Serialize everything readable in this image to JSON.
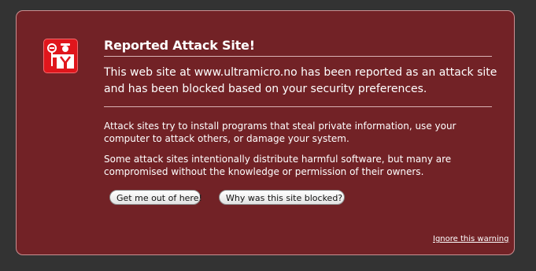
{
  "panel": {
    "title": "Reported Attack Site!",
    "intro": "This web site at www.ultramicro.no has been reported as an attack site and has been blocked based on your security preferences.",
    "paragraphs": [
      "Attack sites try to install programs that steal private information, use your computer to attack others, or damage your system.",
      "Some attack sites intentionally distribute harmful software, but many are compromised without the knowledge or permission of their owners."
    ],
    "buttons": {
      "get_out": "Get me out of here!",
      "why_blocked": "Why was this site blocked?"
    },
    "ignore_link": "Ignore this warning"
  },
  "icon": {
    "name": "security-guard-icon",
    "color": "#e0161c"
  },
  "colors": {
    "background": "#333333",
    "panel": "#722226",
    "panel_border": "#c98f91",
    "text": "#ffffff"
  }
}
